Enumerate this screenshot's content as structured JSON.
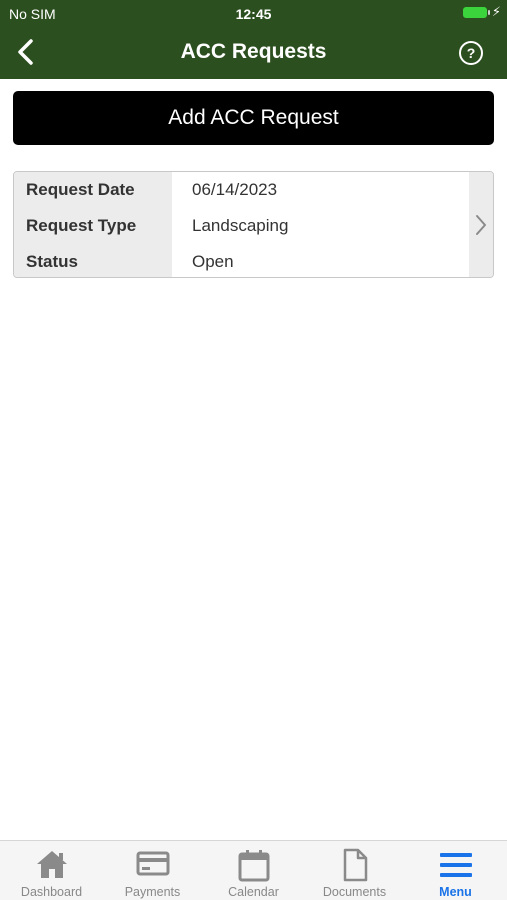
{
  "status_bar": {
    "carrier": "No SIM",
    "time": "12:45",
    "battery_color": "#3cd43c"
  },
  "nav": {
    "title": "ACC Requests",
    "back_icon": "chevron-left-icon",
    "help_icon": "question-circle-icon",
    "help_glyph": "?"
  },
  "add_button": {
    "label": "Add ACC Request"
  },
  "requests": [
    {
      "rows": [
        {
          "label": "Request Date",
          "value": "06/14/2023"
        },
        {
          "label": "Request Type",
          "value": "Landscaping"
        },
        {
          "label": "Status",
          "value": "Open"
        }
      ]
    }
  ],
  "tabbar": {
    "tabs": [
      {
        "label": "Dashboard",
        "icon": "home-icon",
        "active": false
      },
      {
        "label": "Payments",
        "icon": "credit-card-icon",
        "active": false
      },
      {
        "label": "Calendar",
        "icon": "calendar-icon",
        "active": false
      },
      {
        "label": "Documents",
        "icon": "document-icon",
        "active": false
      },
      {
        "label": "Menu",
        "icon": "hamburger-menu-icon",
        "active": true
      }
    ]
  },
  "colors": {
    "header_bg": "#2c4f1f",
    "active_tab": "#1a73e8",
    "inactive_tab": "#888888"
  }
}
